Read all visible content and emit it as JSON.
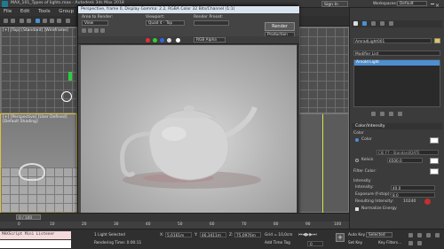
{
  "titlebar": {
    "title": "MAX_101_Types of lights.max - Autodesk 3ds Max 2018",
    "workspaces_label": "Workspaces:",
    "workspace_value": "Default",
    "sign_in": "Sign In"
  },
  "menus": [
    "File",
    "Edit",
    "Tools",
    "Group"
  ],
  "viewports": {
    "top_label": "[+] [Top] [Standard] [Wireframe]",
    "persp_label": "[+] [Perspective] [User Defined] [Default Shading]"
  },
  "render_window": {
    "title": "Perspective, frame 0, Display Gamma: 2.2, RGBA Color 32 Bits/Channel (1:1)",
    "area_to_render_label": "Area to Render:",
    "area_to_render_value": "View",
    "viewport_label": "Viewport:",
    "viewport_value": "Quad 4 - Top",
    "render_preset_label": "Render Preset:",
    "render_button": "Render",
    "production_value": "Production",
    "channel_value": "RGB Alpha"
  },
  "right_panel": {
    "object_name": "AmradLight001",
    "modifier_list": "Modifier List",
    "stack_item": "Arnold Light",
    "section_title": "Color/Intensity",
    "color_label": "Color",
    "color_option": "Color",
    "preset_value": "CIE F7 - Standard/DATE",
    "kelvin_label": "Kelvin",
    "kelvin_value": "6500.0",
    "filter_color_label": "Filter Color:",
    "intensity_section": "Intensity",
    "intensity_label": "Intensity:",
    "intensity_value": "40.0",
    "exposure_label": "Exposure (f-stop):",
    "exposure_value": "8.0",
    "resulting_label": "Resulting Intensity:",
    "resulting_value": "10240",
    "normalize_label": "Normalize Energy"
  },
  "timeline": {
    "frame_counter": "0 / 100",
    "ticks": [
      "0",
      "10",
      "20",
      "30",
      "40",
      "50",
      "60",
      "70",
      "80",
      "90",
      "100"
    ]
  },
  "statusbar": {
    "listener": "MAXScript Mini Listener",
    "selected": "1 Light Selected",
    "rendering_time": "Rendering Time: 0:00:11",
    "x_label": "X:",
    "x_value": "5,6161m",
    "y_label": "Y:",
    "y_value": "46,3411m",
    "z_label": "Z:",
    "z_value": "75,0976m",
    "grid": "Grid = 10,0cm",
    "add_time_tag": "Add Time Tag",
    "auto_key": "Auto Key",
    "auto_key_value": "Selected",
    "set_key": "Set Key",
    "key_filters": "Key Filters...",
    "frame": "0"
  },
  "colors": {
    "accent_blue": "#4d8fcf",
    "record_red": "#c03030",
    "swatch_white": "#ffffff"
  }
}
